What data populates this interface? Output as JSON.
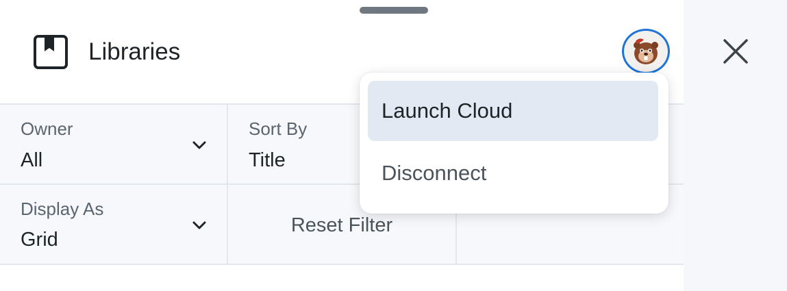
{
  "header": {
    "title": "Libraries",
    "icon": "library-icon",
    "avatar_icon": "beaver-avatar-icon",
    "accent_color": "#1e73d8"
  },
  "filters": {
    "owner": {
      "label": "Owner",
      "value": "All"
    },
    "sort_by": {
      "label": "Sort By",
      "value": "Title"
    },
    "display_as": {
      "label": "Display As",
      "value": "Grid"
    },
    "reset_label": "Reset Filter"
  },
  "account_menu": {
    "items": [
      {
        "label": "Launch Cloud",
        "active": true
      },
      {
        "label": "Disconnect",
        "active": false
      }
    ]
  },
  "close_icon": "close-icon"
}
